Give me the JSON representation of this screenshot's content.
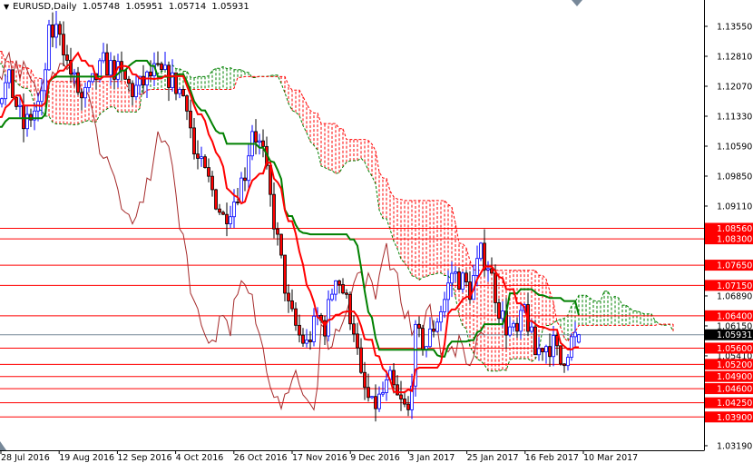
{
  "header": {
    "symbol": "EURUSD,Daily",
    "open": "1.05748",
    "high": "1.05951",
    "low": "1.05714",
    "close": "1.05931"
  },
  "colors": {
    "bull": "#0000ff",
    "bear": "#ff0000",
    "tenkan": "#ff0000",
    "kijun": "#008000",
    "chikou": "#a52a2a",
    "level": "#ff0000",
    "current": "#778899"
  },
  "chart_data": {
    "type": "candlestick",
    "symbol": "EURUSD",
    "timeframe": "Daily",
    "indicators": [
      "Ichimoku Kinko Hyo (tenkan, kijun, chikou, senkou span A/B cloud)"
    ],
    "ylim": [
      1.0319,
      1.1355
    ],
    "y_ticks": [
      "1.13550",
      "1.12810",
      "1.12070",
      "1.11330",
      "1.10590",
      "1.09850",
      "1.09110",
      "1.06890",
      "1.06150",
      "1.05410",
      "1.03190"
    ],
    "x_ticks": [
      "28 Jul 2016",
      "19 Aug 2016",
      "12 Sep 2016",
      "4 Oct 2016",
      "26 Oct 2016",
      "17 Nov 2016",
      "9 Dec 2016",
      "3 Jan 2017",
      "25 Jan 2017",
      "16 Feb 2017",
      "10 Mar 2017"
    ],
    "levels": [
      "1.08560",
      "1.08300",
      "1.07650",
      "1.07150",
      "1.06400",
      "1.05600",
      "1.05200",
      "1.04900",
      "1.04600",
      "1.04250",
      "1.03900"
    ],
    "current_price": "1.05931",
    "last_bar": {
      "open": 1.05748,
      "high": 1.05951,
      "low": 1.05714,
      "close": 1.05931
    },
    "approx_close_path": [
      [
        -80,
        1.135
      ],
      [
        -60,
        1.125
      ],
      [
        -45,
        1.14
      ],
      [
        -30,
        1.12
      ],
      [
        -15,
        1.105
      ],
      [
        -5,
        1.115
      ],
      [
        0,
        1.1196
      ],
      [
        2,
        1.1218
      ],
      [
        6,
        1.1106
      ],
      [
        11,
        1.1173
      ],
      [
        13,
        1.133
      ],
      [
        16,
        1.1353
      ],
      [
        18,
        1.1263
      ],
      [
        22,
        1.1173
      ],
      [
        24,
        1.1196
      ],
      [
        28,
        1.1263
      ],
      [
        32,
        1.1241
      ],
      [
        36,
        1.1196
      ],
      [
        38,
        1.1207
      ],
      [
        42,
        1.1241
      ],
      [
        46,
        1.1229
      ],
      [
        48,
        1.1207
      ],
      [
        51,
        1.1173
      ],
      [
        53,
        1.1039
      ],
      [
        57,
        1.0971
      ],
      [
        61,
        1.0882
      ],
      [
        64,
        1.0927
      ],
      [
        67,
        1.0994
      ],
      [
        69,
        1.1106
      ],
      [
        72,
        1.1039
      ],
      [
        74,
        1.0927
      ],
      [
        77,
        1.077
      ],
      [
        79,
        1.0658
      ],
      [
        82,
        1.059
      ],
      [
        84,
        1.0568
      ],
      [
        87,
        1.0635
      ],
      [
        89,
        1.0613
      ],
      [
        92,
        1.0747
      ],
      [
        94,
        1.0702
      ],
      [
        97,
        1.0613
      ],
      [
        99,
        1.0478
      ],
      [
        102,
        1.0411
      ],
      [
        104,
        1.0433
      ],
      [
        107,
        1.0478
      ],
      [
        109,
        1.0433
      ],
      [
        112,
        1.04
      ],
      [
        114,
        1.059
      ],
      [
        117,
        1.0568
      ],
      [
        119,
        1.0613
      ],
      [
        122,
        1.068
      ],
      [
        124,
        1.0747
      ],
      [
        127,
        1.0725
      ],
      [
        129,
        1.0702
      ],
      [
        132,
        1.0792
      ],
      [
        134,
        1.077
      ],
      [
        137,
        1.0658
      ],
      [
        139,
        1.0613
      ],
      [
        142,
        1.059
      ],
      [
        144,
        1.0658
      ],
      [
        147,
        1.0545
      ],
      [
        149,
        1.0568
      ],
      [
        152,
        1.0568
      ],
      [
        154,
        1.0523
      ],
      [
        157,
        1.0579
      ],
      [
        159,
        1.05931
      ]
    ]
  }
}
